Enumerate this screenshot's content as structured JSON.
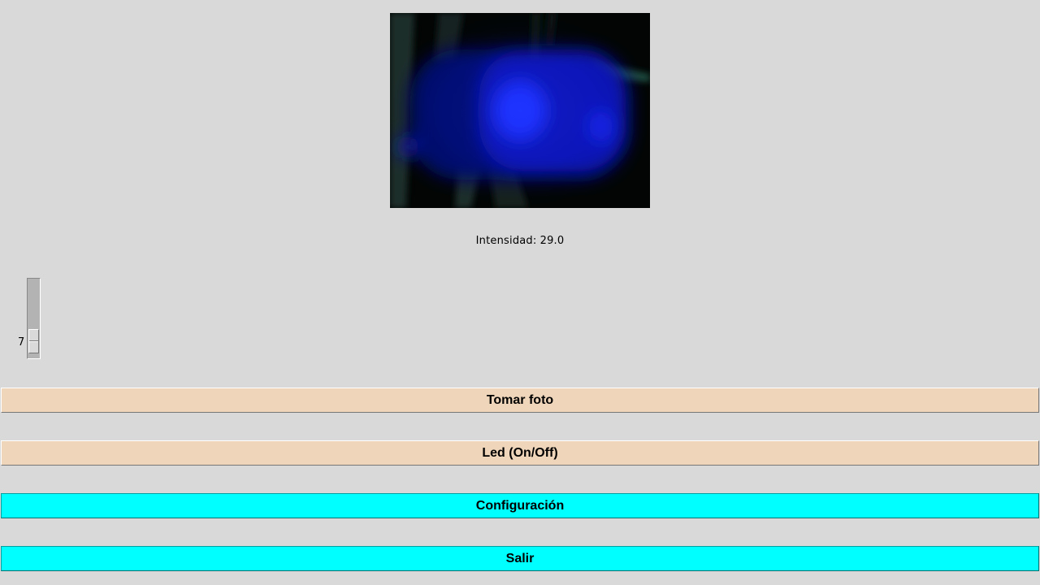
{
  "camera": {
    "icon": "camera-preview"
  },
  "intensity": {
    "label": "Intensidad:",
    "value": "29.0"
  },
  "scale": {
    "value": "7",
    "level_fraction": 0.07
  },
  "buttons": {
    "take_photo": {
      "label": "Tomar foto",
      "color": "#efd5b9"
    },
    "led": {
      "label": "Led (On/Off)",
      "color": "#efd5b9"
    },
    "config": {
      "label": "Configuración",
      "color": "#00ffff"
    },
    "exit": {
      "label": "Salir",
      "color": "#00ffff"
    }
  }
}
